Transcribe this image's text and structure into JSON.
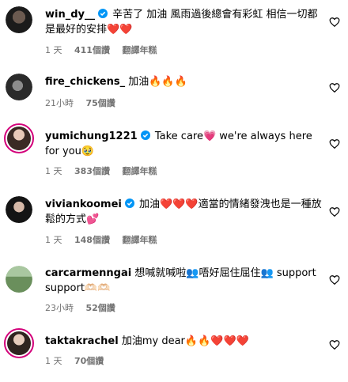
{
  "comments": [
    {
      "username": "win_dy__",
      "verified": true,
      "text": "辛苦了 加油 風雨過後總會有彩虹 相信一切都是最好的安排❤️❤️",
      "time": "1 天",
      "likes": "411個讚",
      "translate": "翻譯年糕",
      "avatar_icon": "avatar-dark-hair"
    },
    {
      "username": "fire_chickens_",
      "verified": false,
      "text": "加油🔥🔥🔥",
      "time": "21小時",
      "likes": "75個讚",
      "translate": "",
      "avatar_icon": "avatar-dark-portrait"
    },
    {
      "username": "yumichung1221",
      "verified": true,
      "text": "Take care💗 we're always here for you🥹",
      "time": "1 天",
      "likes": "383個讚",
      "translate": "翻譯年糕",
      "avatar_icon": "avatar-story-ring"
    },
    {
      "username": "viviankoomei",
      "verified": true,
      "text": "加油❤️❤️❤️適當的情緒發洩也是一種放鬆的方式💕",
      "time": "1 天",
      "likes": "148個讚",
      "translate": "翻譯年糕",
      "avatar_icon": "avatar-dark-hair"
    },
    {
      "username": "carcarmenngai",
      "verified": false,
      "text": "想喊就喊啦👥唔好屈住屈住👥 support support🫶🏻🫶🏻",
      "time": "23小時",
      "likes": "52個讚",
      "translate": "",
      "avatar_icon": "avatar-outdoor"
    },
    {
      "username": "taktakrachel",
      "verified": false,
      "text": "加油my dear🔥🔥❤️❤️❤️",
      "time": "1 天",
      "likes": "70個讚",
      "translate": "",
      "avatar_icon": "avatar-story-ring"
    }
  ],
  "colors": {
    "text": "#000000",
    "meta": "#737373",
    "verified": "#0095f6",
    "story_ring": "#d3007a"
  }
}
